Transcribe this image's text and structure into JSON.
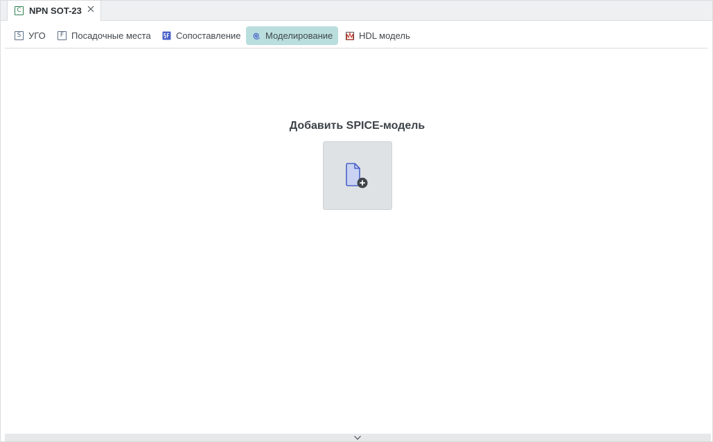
{
  "document_tab": {
    "icon": "component-c-icon",
    "icon_letter": "C",
    "title": "NPN SOT-23",
    "close_icon": "close-icon"
  },
  "view_tabs": [
    {
      "id": "ugo",
      "label": "УГО",
      "icon": "symbol-s-icon",
      "icon_letter": "S",
      "active": false
    },
    {
      "id": "footprints",
      "label": "Посадочные места",
      "icon": "footprint-f-icon",
      "icon_letter": "F",
      "active": false
    },
    {
      "id": "mapping",
      "label": "Сопоставление",
      "icon": "mapping-sf-icon",
      "active": false
    },
    {
      "id": "simulation",
      "label": "Моделирование",
      "icon": "simulation-spiral-icon",
      "active": true
    },
    {
      "id": "hdl",
      "label": "HDL модель",
      "icon": "hdl-model-icon",
      "active": false
    }
  ],
  "main": {
    "title": "Добавить SPICE-модель",
    "add_button_icon": "add-file-icon"
  },
  "bottom_panel": {
    "toggle_icon": "chevron-down-icon"
  },
  "colors": {
    "active_tab_bg": "#b9dedd",
    "icon_blue": "#4a63c9",
    "component_green": "#2e7d4f",
    "hdl_red": "#c0392b"
  }
}
